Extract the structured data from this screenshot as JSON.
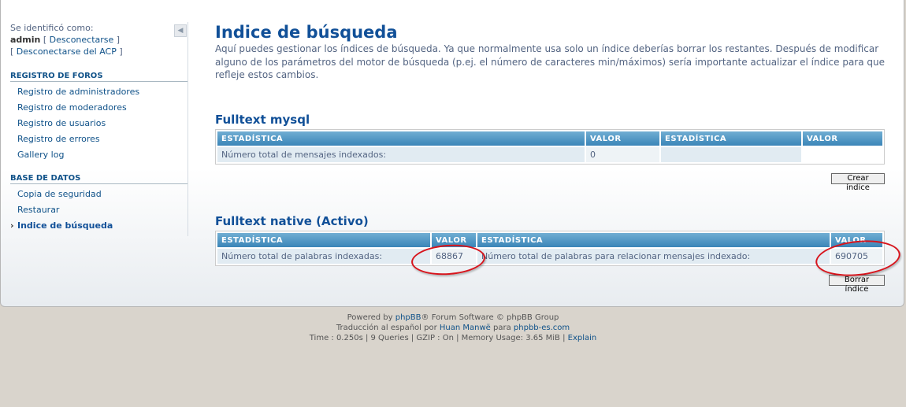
{
  "sidebar": {
    "login_label": "Se identificó como:",
    "username": "admin",
    "logout_link": "Desconectarse",
    "acp_logout_link": "Desconectarse del ACP",
    "sections": [
      {
        "title": "REGISTRO DE FOROS",
        "items": [
          "Registro de administradores",
          "Registro de moderadores",
          "Registro de usuarios",
          "Registro de errores",
          "Gallery log"
        ]
      },
      {
        "title": "BASE DE DATOS",
        "items": [
          "Copia de seguridad",
          "Restaurar",
          "Indice de búsqueda"
        ]
      }
    ],
    "active_item": "Indice de búsqueda"
  },
  "main": {
    "title": "Indice de búsqueda",
    "intro": "Aquí puedes gestionar los índices de búsqueda. Ya que normalmente usa solo un índice deberías borrar los restantes. Después de modificar alguno de los parámetros del motor de búsqueda (p.ej. el número de caracteres min/máximos) sería importante actualizar el índice para que refleje estos cambios.",
    "mysql": {
      "title": "Fulltext mysql",
      "headers": [
        "ESTADÍSTICA",
        "VALOR",
        "ESTADÍSTICA",
        "VALOR"
      ],
      "row": [
        "Número total de mensajes indexados:",
        "0",
        "",
        ""
      ],
      "button": "Crear índice"
    },
    "native": {
      "title": "Fulltext native (Activo)",
      "headers": [
        "ESTADÍSTICA",
        "VALOR",
        "ESTADÍSTICA",
        "VALOR"
      ],
      "row": [
        "Número total de palabras indexadas:",
        "68867",
        "Número total de palabras para relacionar mensajes indexado:",
        "690705"
      ],
      "button": "Borrar índice"
    }
  },
  "footer": {
    "powered_prefix": "Powered by",
    "powered_link": "phpBB",
    "powered_suffix": "® Forum Software © phpBB Group",
    "translation_prefix": "Traducción al español por",
    "translator": "Huan Manwë",
    "translation_mid": "para",
    "translation_site": "phpbb-es.com",
    "debug": "Time : 0.250s | 9 Queries | GZIP : On | Memory Usage: 3.65 MiB |",
    "explain_link": "Explain"
  },
  "colors": {
    "accent": "#115098",
    "header_gradient_top": "#70aed3",
    "header_gradient_bottom": "#3a85b8",
    "annotation_ring": "#d7141c"
  }
}
